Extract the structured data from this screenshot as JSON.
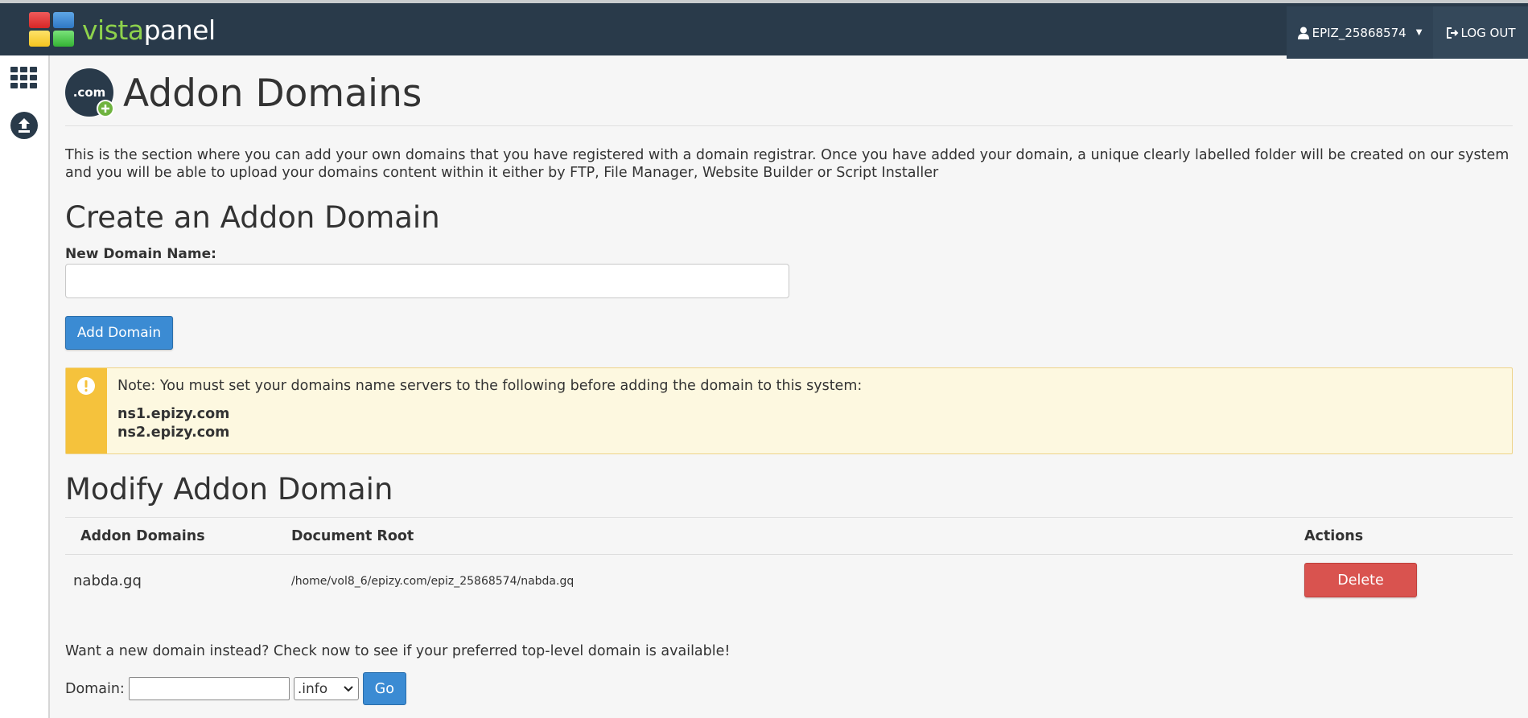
{
  "app": {
    "logo_part1": "vista",
    "logo_part2": "panel"
  },
  "topbar": {
    "username": "EPIZ_25868574",
    "logout_label": "LOG OUT"
  },
  "page": {
    "icon_label": ".com",
    "title": "Addon Domains",
    "intro": "This is the section where you can add your own domains that you have registered with a domain registrar. Once you have added your domain, a unique clearly labelled folder will be created on our system and you will be able to upload your domains content within it either by FTP, File Manager, Website Builder or Script Installer"
  },
  "create": {
    "heading": "Create an Addon Domain",
    "field_label": "New Domain Name:",
    "field_value": "",
    "button_label": "Add Domain"
  },
  "note": {
    "text": "Note: You must set your domains name servers to the following before adding the domain to this system:",
    "nameservers": [
      "ns1.epizy.com",
      "ns2.epizy.com"
    ]
  },
  "modify": {
    "heading": "Modify Addon Domain",
    "columns": [
      "Addon Domains",
      "Document Root",
      "Actions"
    ],
    "rows": [
      {
        "domain": "nabda.gq",
        "document_root": "/home/vol8_6/epizy.com/epiz_25868574/nabda.gq",
        "action_label": "Delete"
      }
    ]
  },
  "domain_search": {
    "promo": "Want a new domain instead? Check now to see if your preferred top-level domain is available!",
    "label": "Domain:",
    "value": "",
    "tld_selected": ".info",
    "go_label": "Go"
  },
  "colors": {
    "topbar": "#293a4a",
    "primary_button": "#3b8bd3",
    "danger_button": "#d9534f",
    "warning_bar": "#f5c23c",
    "warning_bg": "#fdf8e0"
  }
}
